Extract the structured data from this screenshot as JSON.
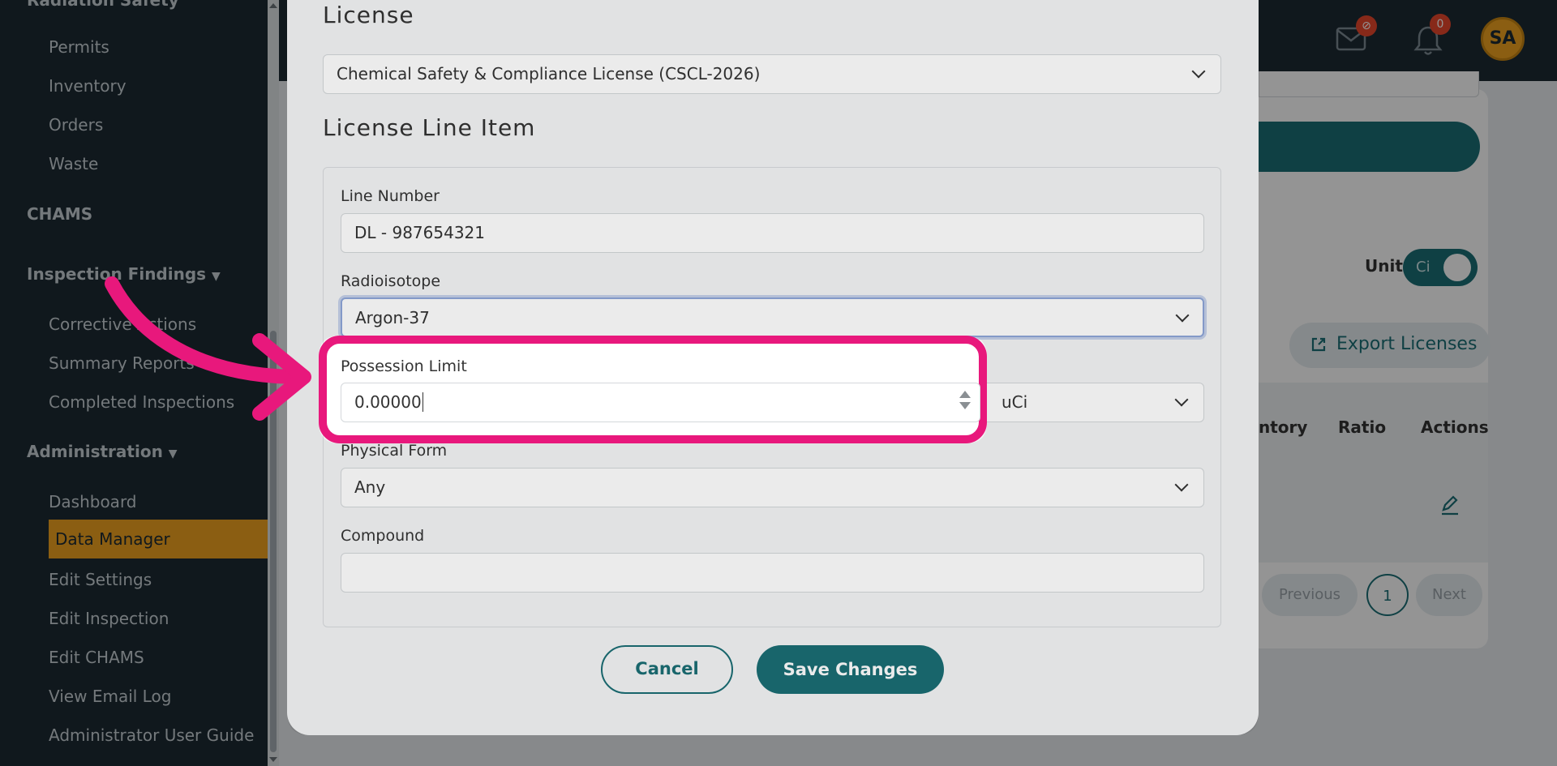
{
  "sidebar": {
    "radiation_safety": "Radiation Safety",
    "items_top": [
      "Permits",
      "Inventory",
      "Orders",
      "Waste"
    ],
    "chams": "CHAMS",
    "inspection_findings": "Inspection Findings",
    "inspection_items": [
      "Corrective Actions",
      "Summary Reports",
      "Completed Inspections"
    ],
    "administration": "Administration",
    "admin_items": [
      "Dashboard",
      "Data Manager",
      "Edit Settings",
      "Edit Inspection",
      "Edit CHAMS",
      "View Email Log",
      "Administrator User Guide"
    ]
  },
  "header": {
    "mail_badge": "⊘",
    "notif_badge": "0",
    "avatar_initials": "SA"
  },
  "background": {
    "unit_label": "Unit:",
    "unit_toggle": "Ci",
    "export_button": "Export Licenses",
    "columns": [
      "ntory",
      "Ratio",
      "Actions"
    ],
    "pager": {
      "previous": "Previous",
      "page": "1",
      "next": "Next"
    }
  },
  "modal": {
    "license_heading": "License",
    "license_value": "Chemical Safety & Compliance License (CSCL-2026)",
    "line_item_heading": "License Line Item",
    "line_number_label": "Line Number",
    "line_number_value": "DL - 987654321",
    "radioisotope_label": "Radioisotope",
    "radioisotope_value": "Argon-37",
    "possession_limit_label": "Possession Limit",
    "possession_limit_value": "0.00000",
    "unit_value": "uCi",
    "physical_form_label": "Physical Form",
    "physical_form_value": "Any",
    "compound_label": "Compound",
    "compound_value": "",
    "cancel_label": "Cancel",
    "save_label": "Save Changes"
  },
  "colors": {
    "accent_teal": "#1b6e75",
    "highlight_pink": "#e8187c",
    "active_orange": "#f0a31f",
    "sidebar_bg": "#1c2a33"
  }
}
